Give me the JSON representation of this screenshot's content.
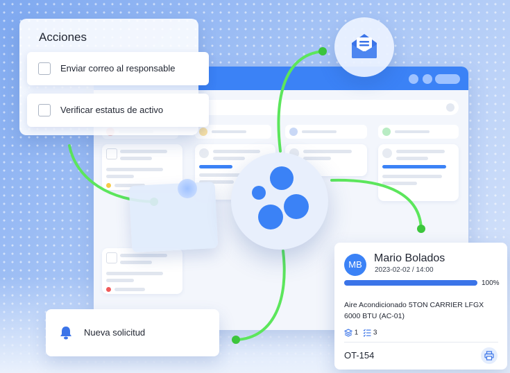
{
  "acciones": {
    "title": "Acciones",
    "items": [
      {
        "label": "Enviar correo al responsable",
        "checked": false
      },
      {
        "label": "Verificar estatus de activo",
        "checked": false
      }
    ]
  },
  "notification": {
    "label": "Nueva solicitud",
    "icon": "bell-icon"
  },
  "mail_icon": "mail-icon",
  "work_order": {
    "avatar_initials": "MB",
    "name": "Mario Bolados",
    "datetime": "2023-02-02 / 14:00",
    "progress_percent": 100,
    "progress_label": "100%",
    "description": "Aire Acondicionado 5TON CARRIER LFGX 6000 BTU (AC-01)",
    "assets_count": "1",
    "tasks_count": "3",
    "id": "OT-154",
    "print_icon": "printer-icon"
  },
  "colors": {
    "accent": "#3b82f6",
    "connector": "#5ce65c",
    "status_red": "#f05a5a",
    "status_yellow": "#f7c948",
    "status_green": "#4cd964"
  }
}
